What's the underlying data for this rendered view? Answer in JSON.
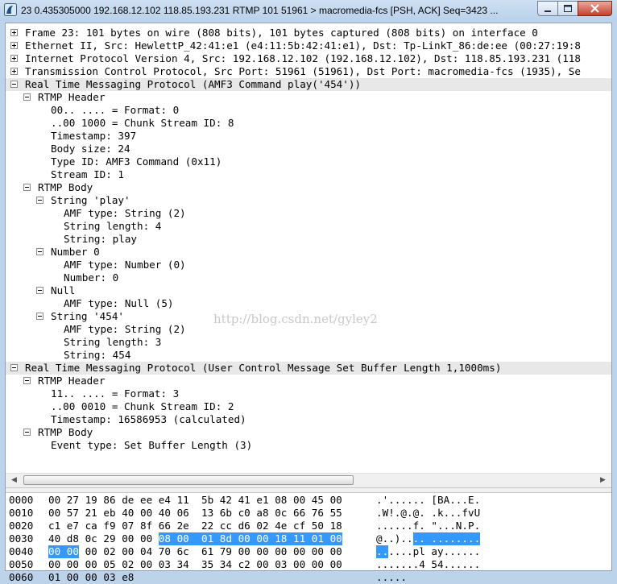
{
  "window": {
    "title": "23 0.435305000 192.168.12.102 118.85.193.231 RTMP 101 51961 > macromedia-fcs [PSH, ACK] Seq=3423 ...",
    "buttons": [
      "minimize",
      "maximize",
      "close"
    ]
  },
  "tree": [
    {
      "indent": 0,
      "toggle": "plus",
      "hl": false,
      "text": "Frame 23: 101 bytes on wire (808 bits), 101 bytes captured (808 bits) on interface 0"
    },
    {
      "indent": 0,
      "toggle": "plus",
      "hl": false,
      "text": "Ethernet II, Src: HewlettP_42:41:e1 (e4:11:5b:42:41:e1), Dst: Tp-LinkT_86:de:ee (00:27:19:8"
    },
    {
      "indent": 0,
      "toggle": "plus",
      "hl": false,
      "text": "Internet Protocol Version 4, Src: 192.168.12.102 (192.168.12.102), Dst: 118.85.193.231 (118"
    },
    {
      "indent": 0,
      "toggle": "plus",
      "hl": false,
      "text": "Transmission Control Protocol, Src Port: 51961 (51961), Dst Port: macromedia-fcs (1935), Se"
    },
    {
      "indent": 0,
      "toggle": "minus",
      "hl": true,
      "text": "Real Time Messaging Protocol (AMF3 Command play('454'))"
    },
    {
      "indent": 1,
      "toggle": "minus",
      "hl": false,
      "text": "RTMP Header"
    },
    {
      "indent": 2,
      "toggle": null,
      "hl": false,
      "text": "00.. .... = Format: 0"
    },
    {
      "indent": 2,
      "toggle": null,
      "hl": false,
      "text": "..00 1000 = Chunk Stream ID: 8"
    },
    {
      "indent": 2,
      "toggle": null,
      "hl": false,
      "text": "Timestamp: 397"
    },
    {
      "indent": 2,
      "toggle": null,
      "hl": false,
      "text": "Body size: 24"
    },
    {
      "indent": 2,
      "toggle": null,
      "hl": false,
      "text": "Type ID: AMF3 Command (0x11)"
    },
    {
      "indent": 2,
      "toggle": null,
      "hl": false,
      "text": "Stream ID: 1"
    },
    {
      "indent": 1,
      "toggle": "minus",
      "hl": false,
      "text": "RTMP Body"
    },
    {
      "indent": 2,
      "toggle": "minus",
      "hl": false,
      "text": "String 'play'"
    },
    {
      "indent": 3,
      "toggle": null,
      "hl": false,
      "text": "AMF type: String (2)"
    },
    {
      "indent": 3,
      "toggle": null,
      "hl": false,
      "text": "String length: 4"
    },
    {
      "indent": 3,
      "toggle": null,
      "hl": false,
      "text": "String: play"
    },
    {
      "indent": 2,
      "toggle": "minus",
      "hl": false,
      "text": "Number 0"
    },
    {
      "indent": 3,
      "toggle": null,
      "hl": false,
      "text": "AMF type: Number (0)"
    },
    {
      "indent": 3,
      "toggle": null,
      "hl": false,
      "text": "Number: 0"
    },
    {
      "indent": 2,
      "toggle": "minus",
      "hl": false,
      "text": "Null"
    },
    {
      "indent": 3,
      "toggle": null,
      "hl": false,
      "text": "AMF type: Null (5)"
    },
    {
      "indent": 2,
      "toggle": "minus",
      "hl": false,
      "text": "String '454'"
    },
    {
      "indent": 3,
      "toggle": null,
      "hl": false,
      "text": "AMF type: String (2)"
    },
    {
      "indent": 3,
      "toggle": null,
      "hl": false,
      "text": "String length: 3"
    },
    {
      "indent": 3,
      "toggle": null,
      "hl": false,
      "text": "String: 454"
    },
    {
      "indent": 0,
      "toggle": "minus",
      "hl": true,
      "text": "Real Time Messaging Protocol (User Control Message Set Buffer Length 1,1000ms)"
    },
    {
      "indent": 1,
      "toggle": "minus",
      "hl": false,
      "text": "RTMP Header"
    },
    {
      "indent": 2,
      "toggle": null,
      "hl": false,
      "text": "11.. .... = Format: 3"
    },
    {
      "indent": 2,
      "toggle": null,
      "hl": false,
      "text": "..00 0010 = Chunk Stream ID: 2"
    },
    {
      "indent": 2,
      "toggle": null,
      "hl": false,
      "text": "Timestamp: 16586953 (calculated)"
    },
    {
      "indent": 1,
      "toggle": "minus",
      "hl": false,
      "text": "RTMP Body"
    },
    {
      "indent": 2,
      "toggle": null,
      "hl": false,
      "text": "Event type: Set Buffer Length (3)"
    }
  ],
  "watermark": "http://blog.csdn.net/gyley2",
  "hex": [
    {
      "offset": "0000",
      "bytes": [
        "00",
        "27",
        "19",
        "86",
        "de",
        "ee",
        "e4",
        "11",
        "5b",
        "42",
        "41",
        "e1",
        "08",
        "00",
        "45",
        "00"
      ],
      "sel": [],
      "ascii": [
        ".'......",
        "[BA...E."
      ],
      "asel": []
    },
    {
      "offset": "0010",
      "bytes": [
        "00",
        "57",
        "21",
        "eb",
        "40",
        "00",
        "40",
        "06",
        "13",
        "6b",
        "c0",
        "a8",
        "0c",
        "66",
        "76",
        "55"
      ],
      "sel": [],
      "ascii": [
        ".W!.@.@.",
        ".k...fvU"
      ],
      "asel": []
    },
    {
      "offset": "0020",
      "bytes": [
        "c1",
        "e7",
        "ca",
        "f9",
        "07",
        "8f",
        "66",
        "2e",
        "22",
        "cc",
        "d6",
        "02",
        "4e",
        "cf",
        "50",
        "18"
      ],
      "sel": [],
      "ascii": [
        "......f.",
        "\"...N.P."
      ],
      "asel": []
    },
    {
      "offset": "0030",
      "bytes": [
        "40",
        "d8",
        "0c",
        "29",
        "00",
        "00",
        "08",
        "00",
        "01",
        "8d",
        "00",
        "00",
        "18",
        "11",
        "01",
        "00"
      ],
      "sel": [
        6,
        7,
        8,
        9,
        10,
        11,
        12,
        13,
        14,
        15
      ],
      "ascii": [
        "@..)....",
        "........"
      ],
      "asel": [
        6,
        7,
        8,
        9,
        10,
        11,
        12,
        13,
        14,
        15
      ]
    },
    {
      "offset": "0040",
      "bytes": [
        "00",
        "00",
        "00",
        "02",
        "00",
        "04",
        "70",
        "6c",
        "61",
        "79",
        "00",
        "00",
        "00",
        "00",
        "00",
        "00"
      ],
      "sel": [
        0,
        1
      ],
      "ascii": [
        "......pl",
        "ay......"
      ],
      "asel": [
        0,
        1
      ]
    },
    {
      "offset": "0050",
      "bytes": [
        "00",
        "00",
        "00",
        "05",
        "02",
        "00",
        "03",
        "34",
        "35",
        "34",
        "c2",
        "00",
        "03",
        "00",
        "00",
        "00"
      ],
      "sel": [],
      "ascii": [
        ".......4",
        "54......"
      ],
      "asel": []
    },
    {
      "offset": "0060",
      "bytes": [
        "01",
        "00",
        "00",
        "03",
        "e8"
      ],
      "sel": [],
      "ascii": [
        ".....",
        ""
      ],
      "asel": []
    }
  ]
}
